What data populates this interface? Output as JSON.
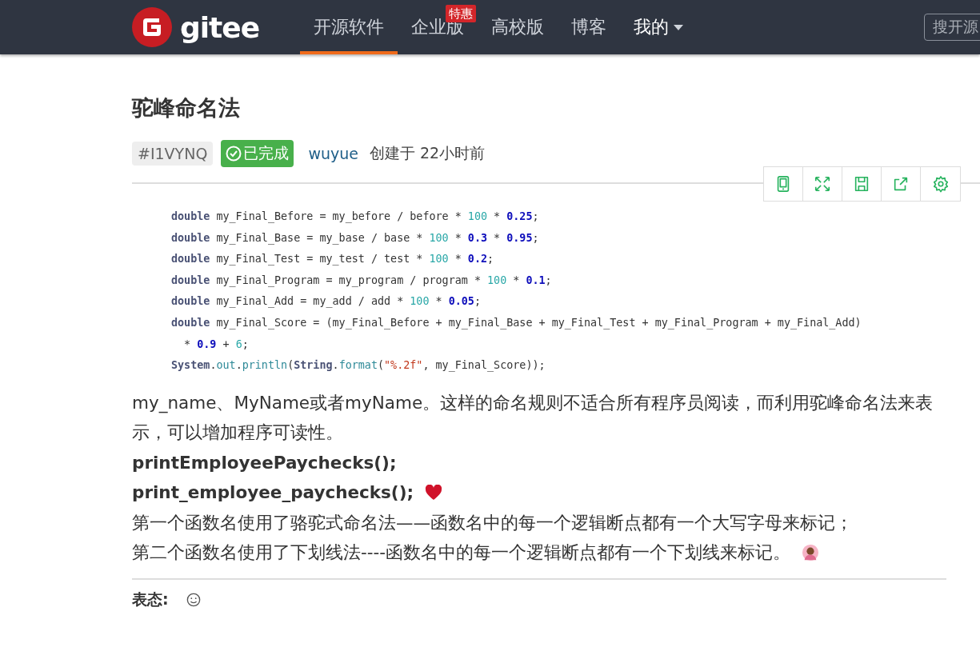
{
  "nav": {
    "logo": "gitee",
    "items": [
      {
        "label": "开源软件",
        "selected": true
      },
      {
        "label": "企业版",
        "selected": false,
        "badge": "特惠"
      },
      {
        "label": "高校版",
        "selected": false
      },
      {
        "label": "博客",
        "selected": false
      },
      {
        "label": "我的",
        "selected": false,
        "dropdown": true
      }
    ],
    "search": {
      "placeholder": "搜开源"
    }
  },
  "issue": {
    "title": "驼峰命名法",
    "id": "#I1VYNQ",
    "status": "已完成",
    "author": "wuyue",
    "created": "创建于 22小时前"
  },
  "code_lines": [
    [
      {
        "t": "double",
        "kind": "kw"
      },
      {
        "t": " my_Final_Before = my_before / before * ",
        "kind": "id"
      },
      {
        "t": "100",
        "kind": "num"
      },
      {
        "t": " * ",
        "kind": "id"
      },
      {
        "t": "0.25",
        "kind": "bnum"
      },
      {
        "t": ";",
        "kind": "id"
      }
    ],
    [
      {
        "t": "double",
        "kind": "kw"
      },
      {
        "t": " my_Final_Base = my_base / base * ",
        "kind": "id"
      },
      {
        "t": "100",
        "kind": "num"
      },
      {
        "t": " * ",
        "kind": "id"
      },
      {
        "t": "0.3",
        "kind": "bnum"
      },
      {
        "t": " * ",
        "kind": "id"
      },
      {
        "t": "0.95",
        "kind": "bnum"
      },
      {
        "t": ";",
        "kind": "id"
      }
    ],
    [
      {
        "t": "double",
        "kind": "kw"
      },
      {
        "t": " my_Final_Test = my_test / test * ",
        "kind": "id"
      },
      {
        "t": "100",
        "kind": "num"
      },
      {
        "t": " * ",
        "kind": "id"
      },
      {
        "t": "0.2",
        "kind": "bnum"
      },
      {
        "t": ";",
        "kind": "id"
      }
    ],
    [
      {
        "t": "double",
        "kind": "kw"
      },
      {
        "t": " my_Final_Program = my_program / program * ",
        "kind": "id"
      },
      {
        "t": "100",
        "kind": "num"
      },
      {
        "t": " * ",
        "kind": "id"
      },
      {
        "t": "0.1",
        "kind": "bnum"
      },
      {
        "t": ";",
        "kind": "id"
      }
    ],
    [
      {
        "t": "double",
        "kind": "kw"
      },
      {
        "t": " my_Final_Add = my_add / add * ",
        "kind": "id"
      },
      {
        "t": "100",
        "kind": "num"
      },
      {
        "t": " * ",
        "kind": "id"
      },
      {
        "t": "0.05",
        "kind": "bnum"
      },
      {
        "t": ";",
        "kind": "id"
      }
    ],
    [
      {
        "t": "double",
        "kind": "kw"
      },
      {
        "t": " my_Final_Score = (my_Final_Before + my_Final_Base + my_Final_Test + my_Final_Program + my_Final_Add)",
        "kind": "id"
      }
    ],
    [
      {
        "t": "  * ",
        "kind": "id"
      },
      {
        "t": "0.9",
        "kind": "bnum"
      },
      {
        "t": " + ",
        "kind": "id"
      },
      {
        "t": "6",
        "kind": "num"
      },
      {
        "t": ";",
        "kind": "id"
      }
    ],
    [
      {
        "t": "System",
        "kind": "kw"
      },
      {
        "t": ".",
        "kind": "id"
      },
      {
        "t": "out",
        "kind": "method"
      },
      {
        "t": ".",
        "kind": "id"
      },
      {
        "t": "println",
        "kind": "method"
      },
      {
        "t": "(",
        "kind": "id"
      },
      {
        "t": "String",
        "kind": "kw"
      },
      {
        "t": ".",
        "kind": "id"
      },
      {
        "t": "format",
        "kind": "method"
      },
      {
        "t": "(",
        "kind": "id"
      },
      {
        "t": "\"%.2f\"",
        "kind": "str"
      },
      {
        "t": ", my_Final_Score));",
        "kind": "id"
      }
    ]
  ],
  "body": [
    {
      "kind": "text",
      "text": "my_name、MyName或者myName。这样的命名规则不适合所有程序员阅读，而利用驼峰命名法来表示，可以增加程序可读性。"
    },
    {
      "kind": "bold",
      "text": "printEmployeePaychecks();"
    },
    {
      "kind": "bold",
      "text": "print_employee_paychecks();",
      "emoji": {
        "kind": "heart"
      }
    },
    {
      "kind": "text",
      "text": "第一个函数名使用了骆驼式命名法——函数名中的每一个逻辑断点都有一个大写字母来标记；"
    },
    {
      "kind": "text",
      "text": "第二个函数名使用了下划线法----函数名中的每一个逻辑断点都有一个下划线来标记。",
      "emoji": {
        "kind": "person"
      }
    }
  ],
  "reactions": {
    "label": "表态:"
  }
}
